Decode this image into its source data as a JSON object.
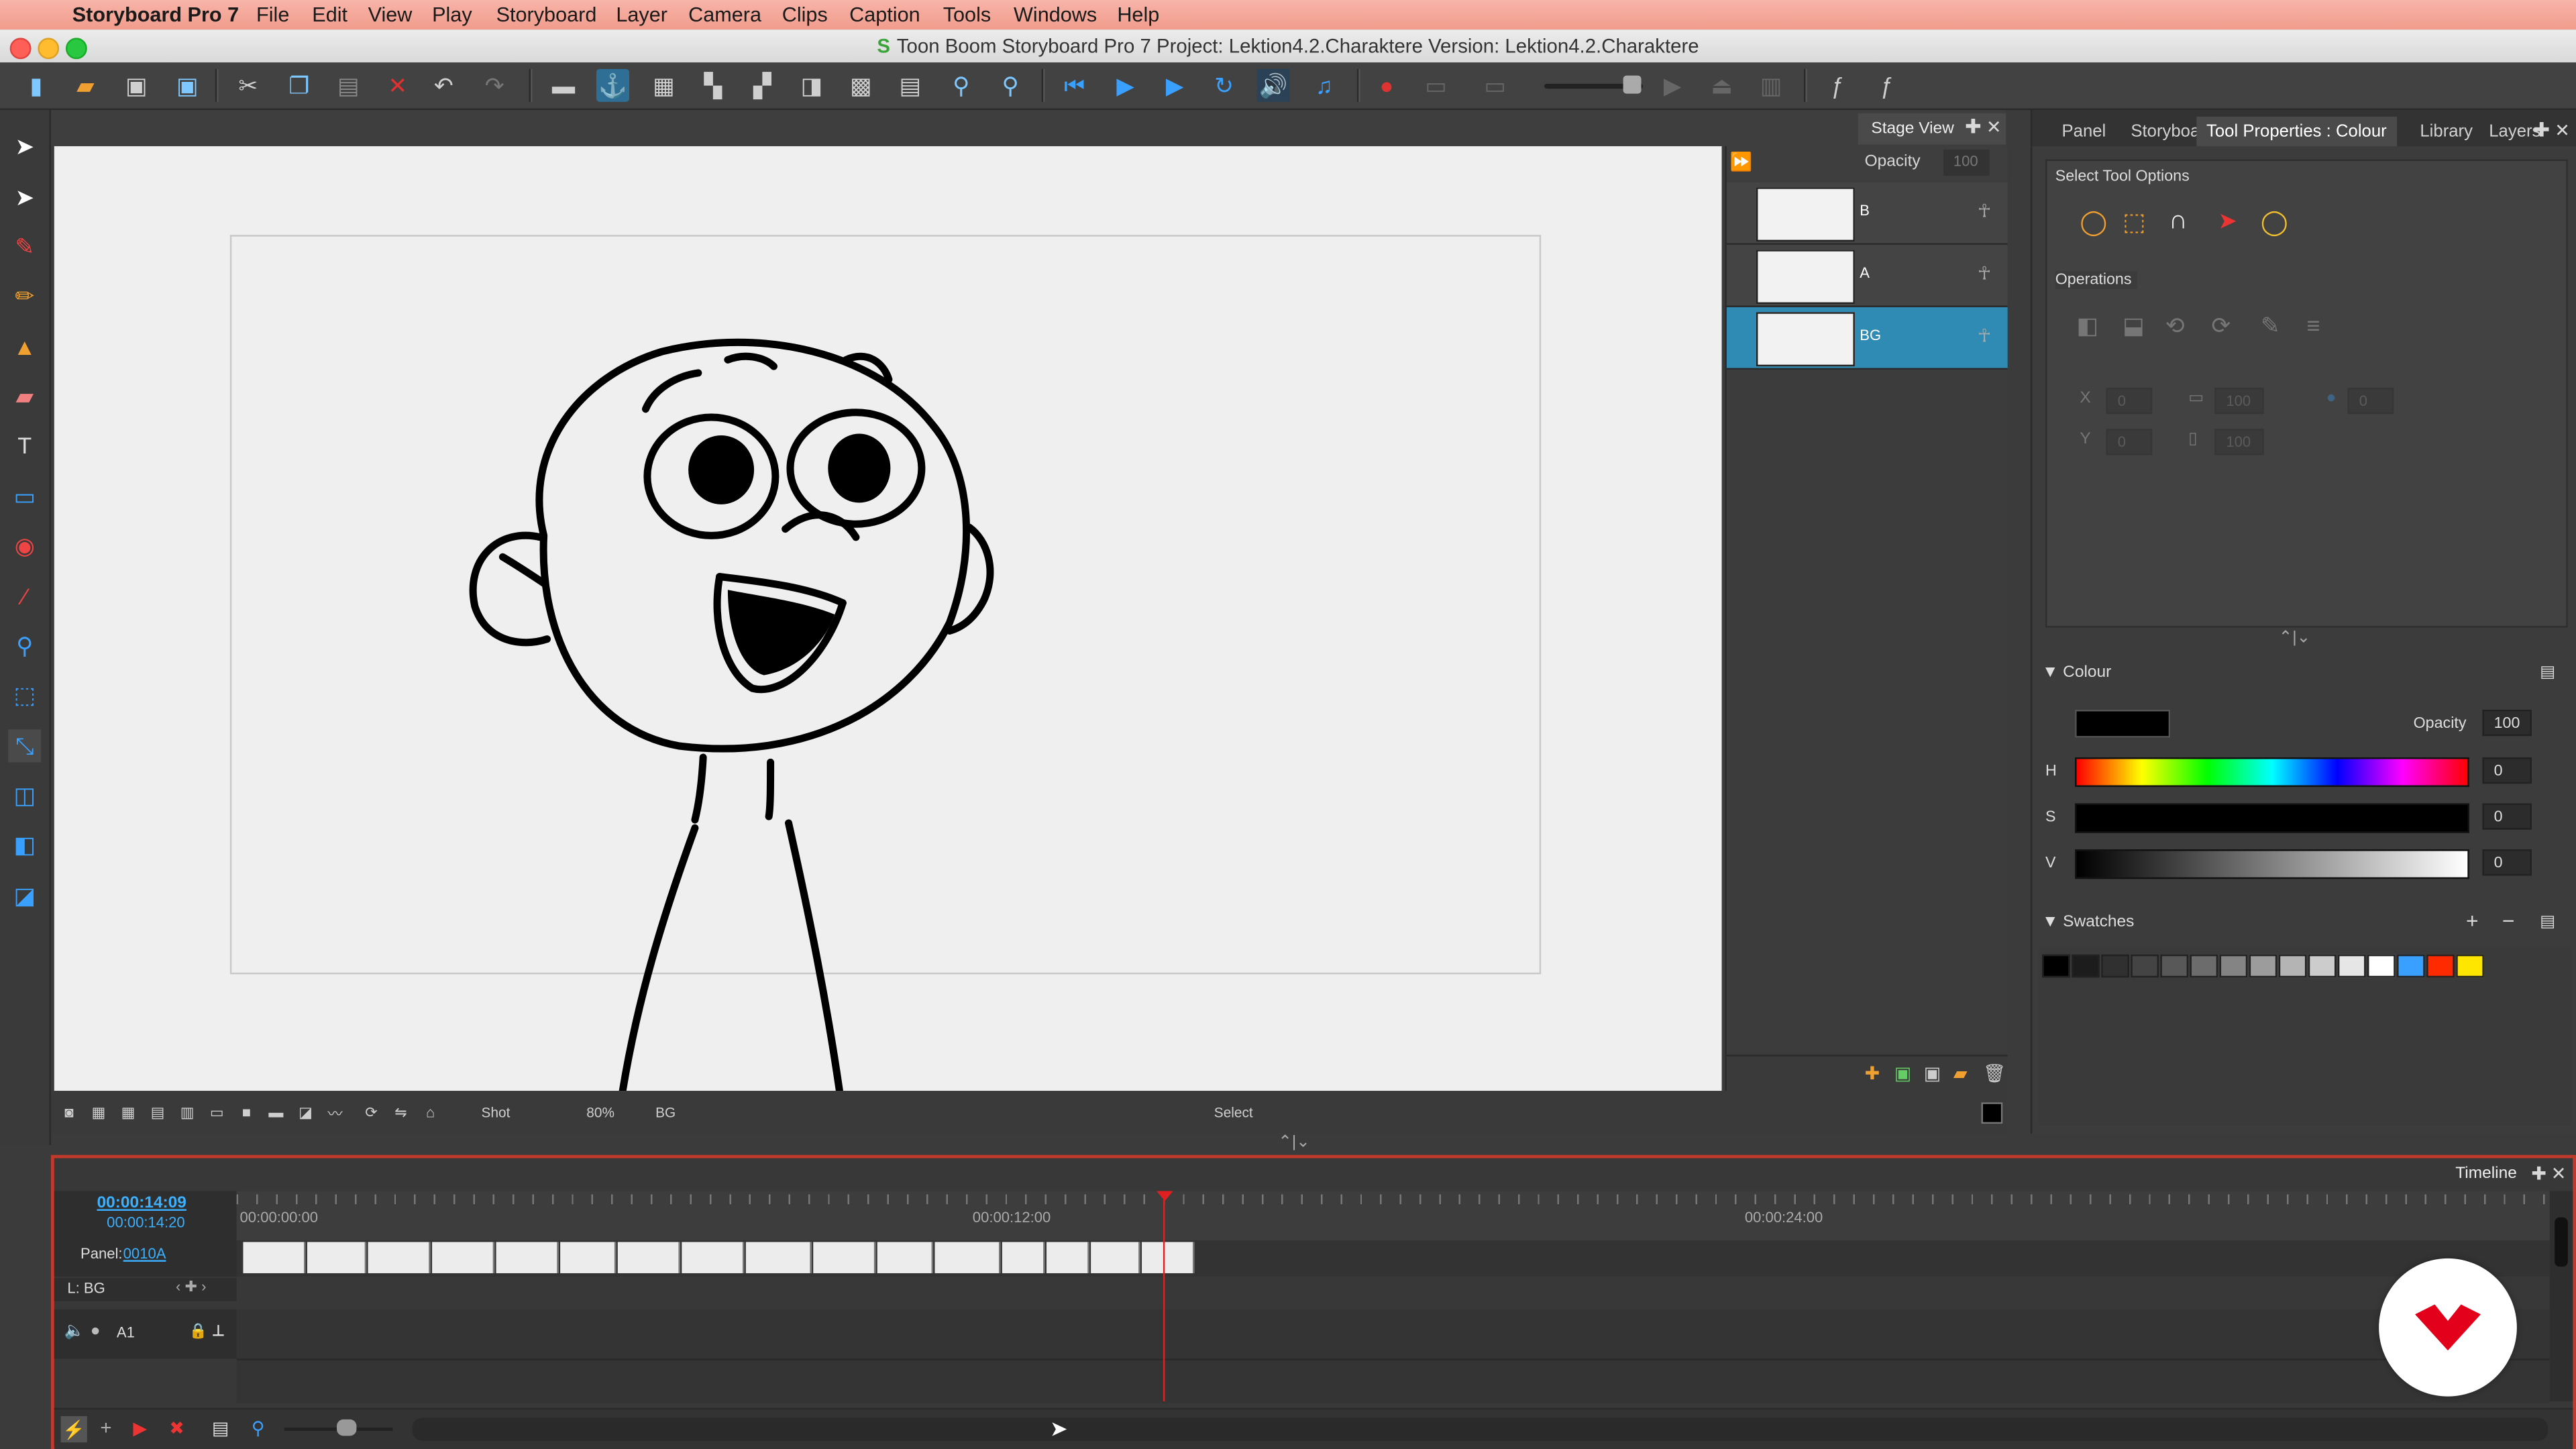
{
  "menubar": {
    "app_name": "Storyboard Pro 7",
    "items": [
      "File",
      "Edit",
      "View",
      "Play",
      "Storyboard",
      "Layer",
      "Camera",
      "Clips",
      "Caption",
      "Tools",
      "Windows",
      "Help"
    ]
  },
  "window": {
    "title": "Toon Boom Storyboard Pro 7 Project: Lektion4.2.Charaktere Version: Lektion4.2.Charaktere",
    "logo_letter": "S"
  },
  "stage_view": {
    "title": "Stage View",
    "opacity_label": "Opacity",
    "opacity_value": "100",
    "bottom_shot": "Shot",
    "bottom_zoom": "80%",
    "bottom_layer": "BG",
    "bottom_status": "Select"
  },
  "layers": [
    {
      "name": "B",
      "selected": false
    },
    {
      "name": "A",
      "selected": false
    },
    {
      "name": "BG",
      "selected": true
    }
  ],
  "right_panel": {
    "tabs": [
      "Panel",
      "Storyboard",
      "Tool Properties : Colour",
      "Library",
      "Layers"
    ],
    "active_tab": "Tool Properties : Colour",
    "select_tool_options": "Select Tool Options",
    "operations": "Operations",
    "op_values": {
      "x": "0",
      "y": "0",
      "w": "100",
      "h": "100",
      "angle": "0"
    },
    "colour_section": "Colour",
    "opacity_label": "Opacity",
    "opacity_value": "100",
    "current_colour": "#000000",
    "h_label": "H",
    "h_value": "0",
    "s_label": "S",
    "s_value": "0",
    "v_label": "V",
    "v_value": "0",
    "swatches_section": "Swatches",
    "swatches": [
      "#000000",
      "#1c1c1c",
      "#303030",
      "#444444",
      "#585858",
      "#6c6c6c",
      "#848484",
      "#9c9c9c",
      "#b4b4b4",
      "#cccccc",
      "#e6e6e6",
      "#ffffff",
      "#3aa0ff",
      "#ff2a00",
      "#ffe600"
    ]
  },
  "timeline": {
    "title": "Timeline",
    "current_time": "00:00:14:09",
    "total_time": "00:00:14:20",
    "ruler_labels": [
      "00:00:00:00",
      "00:00:12:00",
      "00:00:24:00"
    ],
    "panel_label": "Panel:",
    "panel_value": "0010A",
    "layer_label": "L: BG",
    "audio_track": "A1"
  }
}
